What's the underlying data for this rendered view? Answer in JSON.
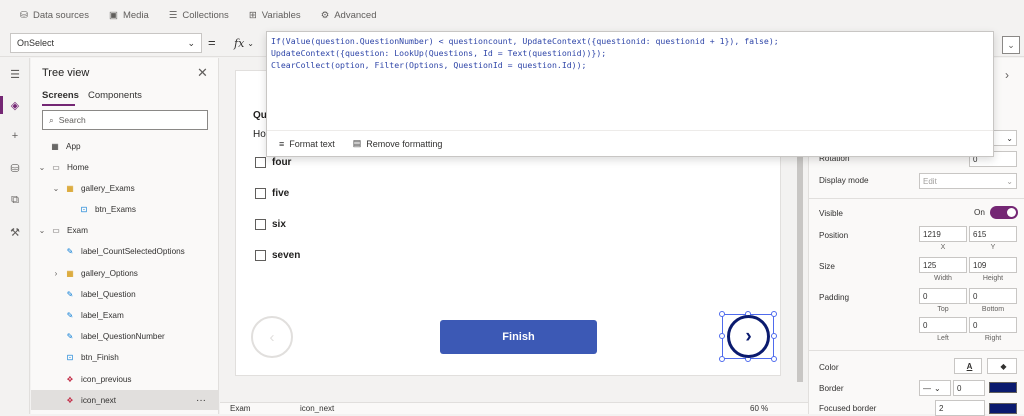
{
  "menubar": {
    "items": [
      {
        "icon": "database-icon",
        "label": "Data sources"
      },
      {
        "icon": "media-icon",
        "label": "Media"
      },
      {
        "icon": "collections-icon",
        "label": "Collections"
      },
      {
        "icon": "variables-icon",
        "label": "Variables"
      },
      {
        "icon": "advanced-icon",
        "label": "Advanced"
      }
    ]
  },
  "formula_bar": {
    "property": "OnSelect",
    "equals": "=",
    "fx": "fx",
    "code": [
      "If(Value(question.QuestionNumber) < questioncount, UpdateContext({questionid: questionid + 1}), false);",
      "UpdateContext({question: LookUp(Questions, Id = Text(questionid))});",
      "ClearCollect(option, Filter(Options, QuestionId = question.Id));"
    ],
    "format_text": "Format text",
    "remove_formatting": "Remove formatting"
  },
  "tree": {
    "title": "Tree view",
    "tabs": {
      "screens": "Screens",
      "components": "Components"
    },
    "search_placeholder": "Search",
    "app": "App",
    "items": [
      {
        "label": "Home",
        "icon": "screen-icon",
        "indent": 0,
        "chev": "v"
      },
      {
        "label": "gallery_Exams",
        "icon": "gallery-icon",
        "indent": 1,
        "chev": "v"
      },
      {
        "label": "btn_Exams",
        "icon": "button-icon",
        "indent": 2,
        "chev": ""
      },
      {
        "label": "Exam",
        "icon": "screen-icon",
        "indent": 0,
        "chev": "v"
      },
      {
        "label": "label_CountSelectedOptions",
        "icon": "label-icon",
        "indent": 1,
        "chev": ""
      },
      {
        "label": "gallery_Options",
        "icon": "gallery-icon",
        "indent": 1,
        "chev": ">"
      },
      {
        "label": "label_Question",
        "icon": "label-icon",
        "indent": 1,
        "chev": ""
      },
      {
        "label": "label_Exam",
        "icon": "label-icon",
        "indent": 1,
        "chev": ""
      },
      {
        "label": "label_QuestionNumber",
        "icon": "label-icon",
        "indent": 1,
        "chev": ""
      },
      {
        "label": "btn_Finish",
        "icon": "button-icon",
        "indent": 1,
        "chev": ""
      },
      {
        "label": "icon_previous",
        "icon": "icon-control-icon",
        "indent": 1,
        "chev": ""
      },
      {
        "label": "icon_next",
        "icon": "icon-control-icon",
        "indent": 1,
        "chev": "",
        "selected": true
      }
    ],
    "more": "···"
  },
  "canvas": {
    "question_label": "Qu",
    "question_sub": "Ho",
    "options": [
      "four",
      "five",
      "six",
      "seven"
    ],
    "finish": "Finish",
    "prev_glyph": "‹",
    "next_glyph": "›"
  },
  "bottombar": {
    "screen": "Exam",
    "control": "icon_next",
    "zoom": "60 %"
  },
  "props": {
    "rotation_label": "Rotation",
    "rotation": "0",
    "display_mode_label": "Display mode",
    "display_mode": "Edit",
    "visible_label": "Visible",
    "visible_state": "On",
    "position_label": "Position",
    "x": "1219",
    "y": "615",
    "x_cap": "X",
    "y_cap": "Y",
    "size_label": "Size",
    "width": "125",
    "height": "109",
    "width_cap": "Width",
    "height_cap": "Height",
    "padding_label": "Padding",
    "pad_top": "0",
    "pad_bottom": "0",
    "pad_left": "0",
    "pad_right": "0",
    "top_cap": "Top",
    "bottom_cap": "Bottom",
    "left_cap": "Left",
    "right_cap": "Right",
    "color_label": "Color",
    "color_glyph": "A",
    "border_label": "Border",
    "border_width": "0",
    "focused_border_label": "Focused border",
    "focused_border": "2",
    "accent": "#742774",
    "icon_color": "#0a1a6e",
    "button_color": "#3c59b5"
  }
}
